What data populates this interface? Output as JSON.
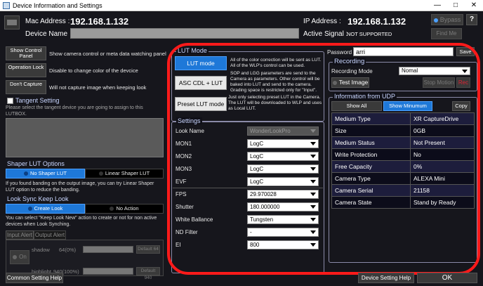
{
  "window": {
    "title": "Device Information and Settings"
  },
  "header": {
    "mac_label": "Mac Address :",
    "mac_value": "192.168.1.132",
    "ip_label": "IP Address :",
    "ip_value": "192.168.1.132",
    "bypass": "Bypass",
    "help": "?",
    "device_name_label": "Device Name",
    "active_signal_label": "Active Signal :",
    "active_signal_value": "NOT SUPPORTED",
    "find_me": "Find Me"
  },
  "left": {
    "show_control_panel": "Show Control Panel",
    "show_control_panel_desc": "Show camera control or meta data watching panel",
    "operation_lock": "Operation Lock",
    "operation_lock_desc": "Disable to change color of the devcice",
    "dont_capture": "Don't Capture",
    "dont_capture_desc": "Will not capture image when keeping look",
    "tangent_title": "Tangent Setting",
    "tangent_desc": "Please select the tangent device you are going to assign to this LUTBOX.",
    "shaper_title": "Shaper LUT Options",
    "no_shaper": "No Shaper LUT",
    "linear_shaper": "Linear Shaper LUT",
    "shaper_desc": "If you found banding on the output image, you can try Linear Shaper LUT option to reduce the banding.",
    "look_sync_title": "Look Sync Keep Look",
    "create_look": "Create Look",
    "no_action": "No Action",
    "look_sync_desc": "You can select \"Keep Look New\" action to create or not for non active devices when Look Synching.",
    "tab_input_alert": "Input Alert",
    "tab_output_alert": "Output Alert",
    "alert_on": "On",
    "shadow_label": "shadow",
    "shadow_value": "64(0%)",
    "highlight_label": "highlight",
    "highlight_value": "940(100%)",
    "default64": "Default 64",
    "default940": "Default 940",
    "common_help": "Common Setting Help"
  },
  "lut_mode": {
    "title": "LUT Mode",
    "lut_mode_btn": "LUT mode",
    "lut_mode_desc": "All of the color correction will be sent as LUT. All of the WLP's control can be used.",
    "asc_btn": "ASC CDL + LUT",
    "asc_desc": "SOP and LGG parameters are send to the Camera as parameters. Other control will be baked into LUT and send to the camera. Grading space is restricted only for \"Input\".",
    "preset_btn": "Preset LUT mode",
    "preset_desc": "Just only selecting preset LUT in the Camera. The LUT will be downloaded to WLP and uses as Local LUT."
  },
  "settings": {
    "title": "Settings",
    "rows": [
      {
        "label": "Look Name",
        "value": "WonderLookPro",
        "disabled": true
      },
      {
        "label": "MON1",
        "value": "LogC"
      },
      {
        "label": "MON2",
        "value": "LogC"
      },
      {
        "label": "MON3",
        "value": "LogC"
      },
      {
        "label": "EVF",
        "value": "LogC"
      },
      {
        "label": "FPS",
        "value": "29.970028"
      },
      {
        "label": "Shutter",
        "value": "180.000000"
      },
      {
        "label": "White Ballance",
        "value": "Tungsten"
      },
      {
        "label": "ND Filter",
        "value": "-"
      },
      {
        "label": "EI",
        "value": "800"
      }
    ]
  },
  "right": {
    "password_label": "Password",
    "password_value": "arri",
    "save": "Save",
    "recording_title": "Recording",
    "recording_mode_label": "Recording Mode",
    "recording_mode_value": "Nomal",
    "test_image": "Test Image",
    "stop_motion": "Stop Motion",
    "rec": "Rec",
    "udp_title": "Information from UDP",
    "show_all": "Show All",
    "show_minimum": "Show Minumum",
    "copy": "Copy",
    "udp_rows": [
      [
        "Medium Type",
        "XR CaptureDrive"
      ],
      [
        "Size",
        "0GB"
      ],
      [
        "Medium Status",
        "Not Present"
      ],
      [
        "Write Protection",
        "No"
      ],
      [
        "Free Capacity",
        "0%"
      ],
      [
        "Camera Type",
        "ALEXA Mini"
      ],
      [
        "Camera Serial",
        "21158"
      ],
      [
        "Camera State",
        "Stand by Ready"
      ]
    ]
  },
  "footer": {
    "device_help": "Device Setting Help",
    "ok": "OK"
  },
  "colors": {
    "accent": "#1e78d8",
    "highlight_outline": "#ff1a1a"
  }
}
